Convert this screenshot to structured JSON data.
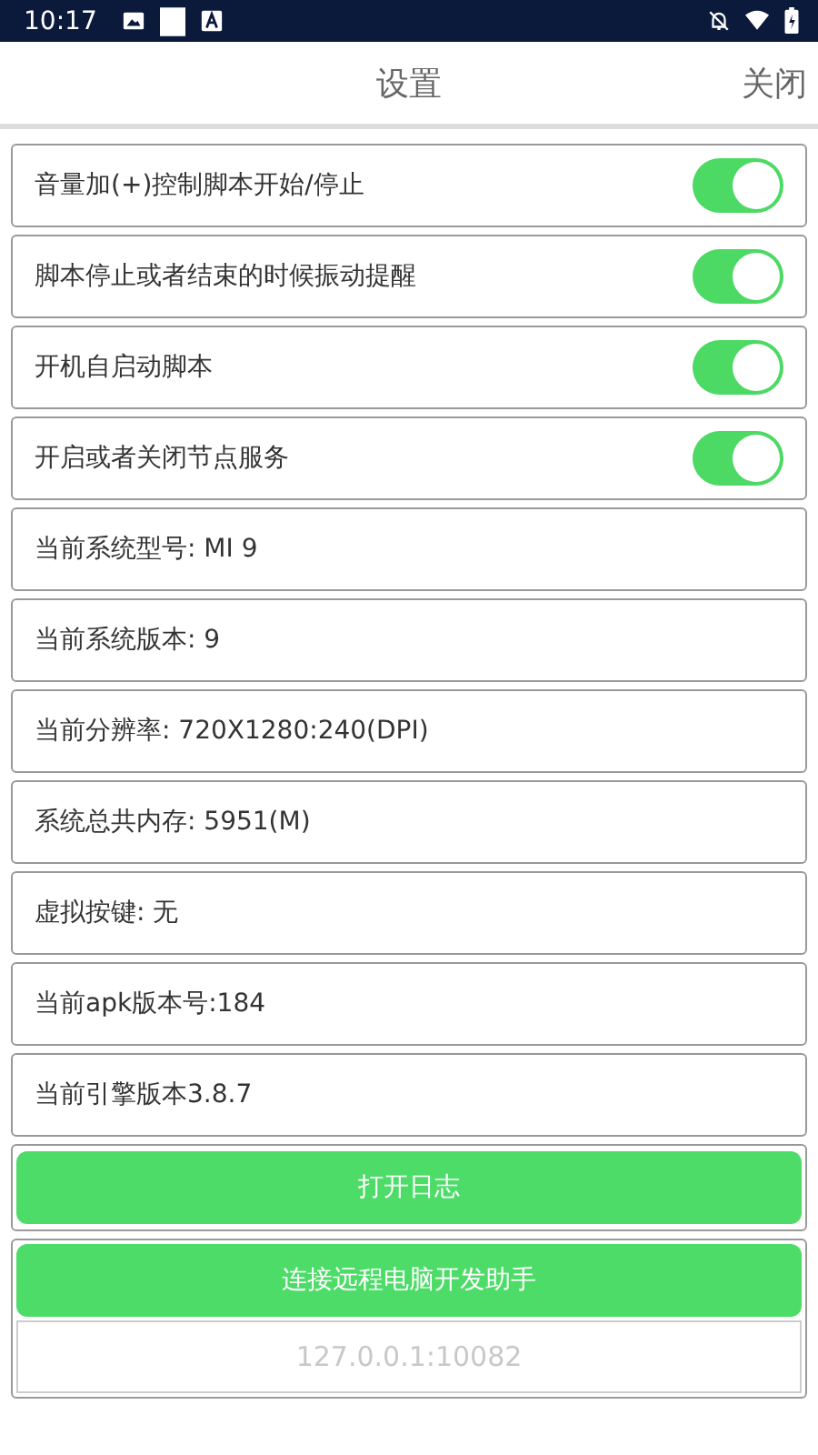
{
  "status_bar": {
    "time": "10:17"
  },
  "header": {
    "title": "设置",
    "close": "关闭"
  },
  "settings": [
    {
      "kind": "toggle",
      "label": "音量加(+)控制脚本开始/停止",
      "on": true
    },
    {
      "kind": "toggle",
      "label": "脚本停止或者结束的时候振动提醒",
      "on": true
    },
    {
      "kind": "toggle",
      "label": "开机自启动脚本",
      "on": true
    },
    {
      "kind": "toggle",
      "label": "开启或者关闭节点服务",
      "on": true
    },
    {
      "kind": "info",
      "label": "当前系统型号: MI 9"
    },
    {
      "kind": "info",
      "label": "当前系统版本: 9"
    },
    {
      "kind": "info",
      "label": "当前分辨率: 720X1280:240(DPI)"
    },
    {
      "kind": "info",
      "label": "系统总共内存: 5951(M)"
    },
    {
      "kind": "info",
      "label": "虚拟按键: 无"
    },
    {
      "kind": "info",
      "label": "当前apk版本号:184"
    },
    {
      "kind": "info",
      "label": "当前引擎版本3.8.7"
    }
  ],
  "log_button": "打开日志",
  "remote": {
    "button": "连接远程电脑开发助手",
    "placeholder": "127.0.0.1:10082"
  }
}
